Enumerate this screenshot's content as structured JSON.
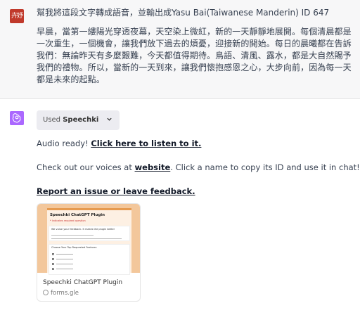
{
  "user": {
    "avatar_text": "卉妤",
    "prompt": "幫我將這段文字轉成語音，並輸出成Yasu Bai(Taiwanese Manderin) ID 647",
    "body": "早晨，當第一縷陽光穿透夜幕，天空染上微紅，新的一天靜靜地展開。每個清晨都是一次重生，一個機會，讓我們放下過去的煩憂，迎接新的開始。每日的晨曦都在告訴我們：無論昨天有多麼艱難，今天都值得期待。鳥語、清風、露水，都是大自然賜予我們的禮物。所以，當新的一天到來，讓我們懷抱感恩之心，大步向前，因為每一天都是未來的起點。"
  },
  "assistant": {
    "plugin_used_prefix": "Used",
    "plugin_name": "Speechki",
    "line1_prefix": "Audio ready! ",
    "line1_link": "Click here to listen to it.",
    "line2_prefix": "Check out our voices at ",
    "line2_link": "website",
    "line2_suffix": ". Click a name to copy its ID and use it in chat!",
    "line3_link": "Report an issue or leave feedback.",
    "card": {
      "thumb_title": "Speechki ChatGPT Plugin",
      "thumb_subtitle": "* Indicates required question",
      "thumb_box1": "We value your feedback. It makes the plugin better",
      "thumb_box2": "Choose Your Top Requested Features",
      "title": "Speechki ChatGPT Plugin",
      "domain": "forms.gle"
    }
  },
  "colors": {
    "user_avatar": "#c0392b",
    "bot_avatar": "#ab68ff",
    "thumb_bg": "#f3c79b",
    "thumb_accent": "#e69a4f"
  }
}
